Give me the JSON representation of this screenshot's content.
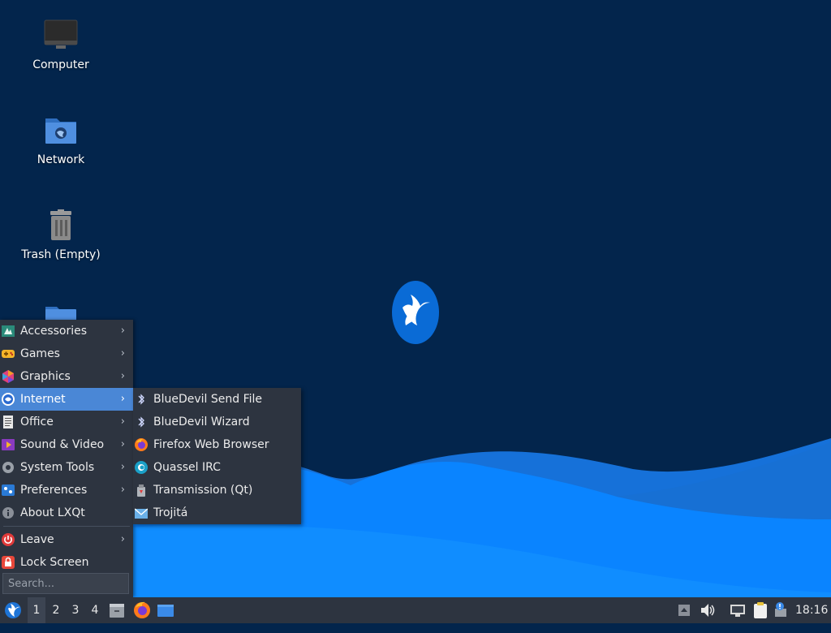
{
  "desktop": {
    "icons": [
      {
        "label": "Computer"
      },
      {
        "label": "Network"
      },
      {
        "label": "Trash (Empty)"
      }
    ]
  },
  "main_menu": {
    "items": [
      {
        "label": "Accessories",
        "icon": "accessories-icon",
        "submenu": true
      },
      {
        "label": "Games",
        "icon": "games-icon",
        "submenu": true
      },
      {
        "label": "Graphics",
        "icon": "graphics-icon",
        "submenu": true
      },
      {
        "label": "Internet",
        "icon": "internet-icon",
        "submenu": true,
        "selected": true
      },
      {
        "label": "Office",
        "icon": "office-icon",
        "submenu": true
      },
      {
        "label": "Sound & Video",
        "icon": "sound-video-icon",
        "submenu": true
      },
      {
        "label": "System Tools",
        "icon": "system-tools-icon",
        "submenu": true
      },
      {
        "label": "Preferences",
        "icon": "preferences-icon",
        "submenu": true
      },
      {
        "label": "About LXQt",
        "icon": "info-icon",
        "submenu": false
      },
      {
        "label": "Leave",
        "icon": "power-icon",
        "submenu": true
      },
      {
        "label": "Lock Screen",
        "icon": "lock-icon",
        "submenu": false
      }
    ],
    "search_placeholder": "Search..."
  },
  "internet_submenu": {
    "items": [
      {
        "label": "BlueDevil Send File",
        "icon": "bluetooth-icon"
      },
      {
        "label": "BlueDevil Wizard",
        "icon": "bluetooth-icon"
      },
      {
        "label": "Firefox Web Browser",
        "icon": "firefox-icon"
      },
      {
        "label": "Quassel IRC",
        "icon": "quassel-icon"
      },
      {
        "label": "Transmission (Qt)",
        "icon": "transmission-icon"
      },
      {
        "label": "Trojitá",
        "icon": "mail-icon"
      }
    ]
  },
  "taskbar": {
    "desktops": [
      "1",
      "2",
      "3",
      "4"
    ],
    "active_desktop": "1",
    "clock": "18:16"
  },
  "colors": {
    "desktop_bg": "#03254c",
    "wave_light": "#1e8fff",
    "panel_bg": "#2d3440",
    "menu_selected": "#4a87d6"
  }
}
